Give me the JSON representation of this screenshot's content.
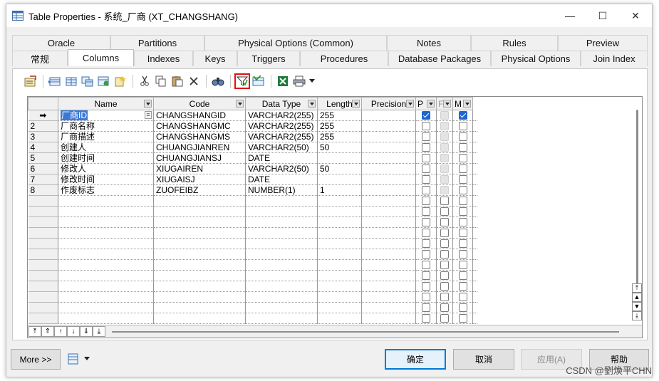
{
  "window": {
    "title": "Table Properties - 系统_厂商 (XT_CHANGSHANG)",
    "controls": {
      "minimize": "—",
      "maximize": "☐",
      "close": "✕"
    }
  },
  "tabs": {
    "row1": [
      "Oracle",
      "Partitions",
      "Physical Options (Common)",
      "Notes",
      "Rules",
      "Preview"
    ],
    "row2": [
      "常规",
      "Columns",
      "Indexes",
      "Keys",
      "Triggers",
      "Procedures",
      "Database Packages",
      "Physical Options",
      "Join Index"
    ],
    "active": "Columns"
  },
  "toolbar": {
    "icons": [
      "properties-icon",
      "add-row-icon",
      "insert-row-icon",
      "add-columns-icon",
      "reuse-columns-icon",
      "new-icon",
      "cut-icon",
      "copy-icon",
      "paste-icon",
      "delete-icon",
      "find-icon",
      "filter-icon",
      "customize-columns-icon",
      "excel-export-icon",
      "print-icon",
      "dropdown-icon"
    ],
    "highlighted": "filter-icon"
  },
  "grid": {
    "headers": [
      "Name",
      "Code",
      "Data Type",
      "Length",
      "Precision",
      "P",
      "F",
      "M"
    ],
    "rows": [
      {
        "marker": "➡",
        "name": "厂商ID",
        "code": "CHANGSHANGID",
        "type": "VARCHAR2(255)",
        "length": "255",
        "precision": "",
        "p": true,
        "f": false,
        "m": true
      },
      {
        "marker": "2",
        "name": "厂商名称",
        "code": "CHANGSHANGMC",
        "type": "VARCHAR2(255)",
        "length": "255",
        "precision": "",
        "p": false,
        "f": false,
        "m": false
      },
      {
        "marker": "3",
        "name": "厂商描述",
        "code": "CHANGSHANGMS",
        "type": "VARCHAR2(255)",
        "length": "255",
        "precision": "",
        "p": false,
        "f": false,
        "m": false
      },
      {
        "marker": "4",
        "name": "创建人",
        "code": "CHUANGJIANREN",
        "type": "VARCHAR2(50)",
        "length": "50",
        "precision": "",
        "p": false,
        "f": false,
        "m": false
      },
      {
        "marker": "5",
        "name": "创建时间",
        "code": "CHUANGJIANSJ",
        "type": "DATE",
        "length": "",
        "precision": "",
        "p": false,
        "f": false,
        "m": false
      },
      {
        "marker": "6",
        "name": "修改人",
        "code": "XIUGAIREN",
        "type": "VARCHAR2(50)",
        "length": "50",
        "precision": "",
        "p": false,
        "f": false,
        "m": false
      },
      {
        "marker": "7",
        "name": "修改时间",
        "code": "XIUGAISJ",
        "type": "DATE",
        "length": "",
        "precision": "",
        "p": false,
        "f": false,
        "m": false
      },
      {
        "marker": "8",
        "name": "作废标志",
        "code": "ZUOFEIBZ",
        "type": "NUMBER(1)",
        "length": "1",
        "precision": "",
        "p": false,
        "f": false,
        "m": false
      }
    ],
    "empty_rows": 12
  },
  "bottom": {
    "more": "More >>",
    "ok": "确定",
    "cancel": "取消",
    "apply": "应用(A)",
    "help": "帮助"
  },
  "watermark": "CSDN @劉煥平CHN"
}
